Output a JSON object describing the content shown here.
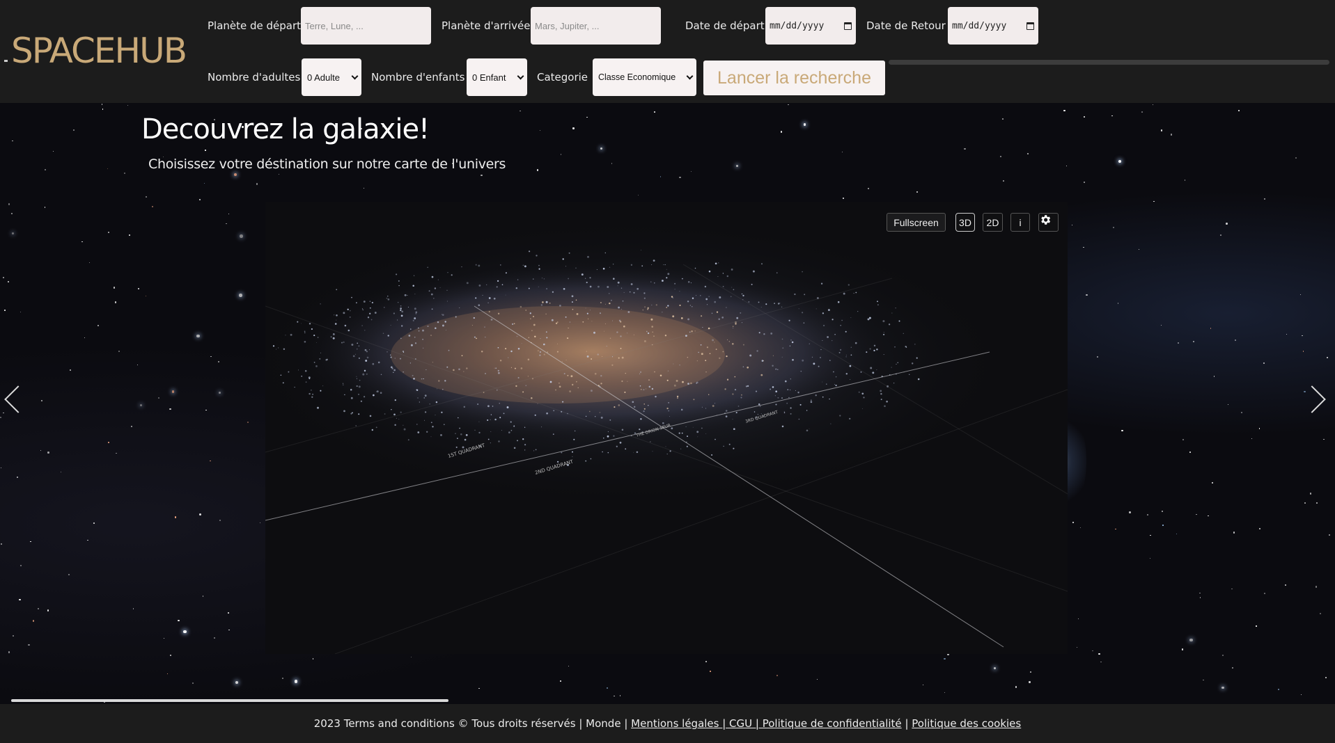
{
  "brand": {
    "logo": "SPACEHUB",
    "accent": "#c9a978"
  },
  "search": {
    "departure_label": "Planète de départ",
    "departure_placeholder": "Terre, Lune, ...",
    "arrival_label": "Planète d'arrivée",
    "arrival_placeholder": "Mars, Jupiter, ...",
    "date_depart_label": "Date de départ",
    "date_depart_value": "mm/dd/yyyy",
    "date_return_label": "Date de Retour",
    "date_return_value": "mm/dd/yyyy",
    "adults_label": "Nombre d'adultes",
    "adults_value": "0 Adulte",
    "children_label": "Nombre d'enfants",
    "children_value": "0 Enfant",
    "category_label": "Categorie",
    "category_value": "Classe Economique",
    "submit_label": "Lancer la recherche"
  },
  "hero": {
    "title": "Decouvrez la galaxie!",
    "subtitle": "Choisissez votre déstination sur notre carte de l'univers"
  },
  "map": {
    "controls": {
      "fullscreen": "Fullscreen",
      "view3d": "3D",
      "view2d": "2D",
      "info": "i",
      "settings_icon": "gear-icon"
    },
    "labels": [
      "1ST QUADRANT",
      "2ND QUADRANT",
      "THE ORION SPUR",
      "3RD QUADRANT"
    ]
  },
  "footer": {
    "text": "2023 Terms and conditions © Tous droits réservés | Monde |",
    "link_legal": "Mentions légales | CGU | Politique de confidentialité",
    "separator": "|",
    "link_cookies": "Politique des cookies"
  }
}
